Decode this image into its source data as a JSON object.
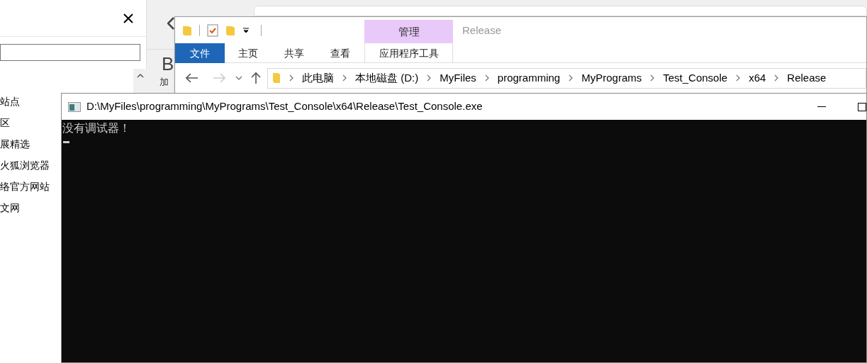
{
  "browser_panel": {
    "sidebar_items": [
      "站点",
      "区",
      "展精选",
      "火狐浏览器",
      "络官方网站",
      "文网"
    ]
  },
  "page_fragment": {
    "letter": "B",
    "label": "加"
  },
  "explorer": {
    "context_group": "管理",
    "title": "Release",
    "ribbon_tabs": [
      {
        "label": "文件",
        "kind": "file",
        "selected": false
      },
      {
        "label": "主页",
        "kind": "tab",
        "selected": false
      },
      {
        "label": "共享",
        "kind": "tab",
        "selected": false
      },
      {
        "label": "查看",
        "kind": "tab",
        "selected": false
      },
      {
        "label": "应用程序工具",
        "kind": "context",
        "selected": false
      }
    ],
    "breadcrumbs": [
      "此电脑",
      "本地磁盘 (D:)",
      "MyFiles",
      "programming",
      "MyPrograms",
      "Test_Console",
      "x64",
      "Release"
    ]
  },
  "console": {
    "title": "D:\\MyFiles\\programming\\MyPrograms\\Test_Console\\x64\\Release\\Test_Console.exe",
    "lines": [
      "没有调试器！"
    ]
  }
}
